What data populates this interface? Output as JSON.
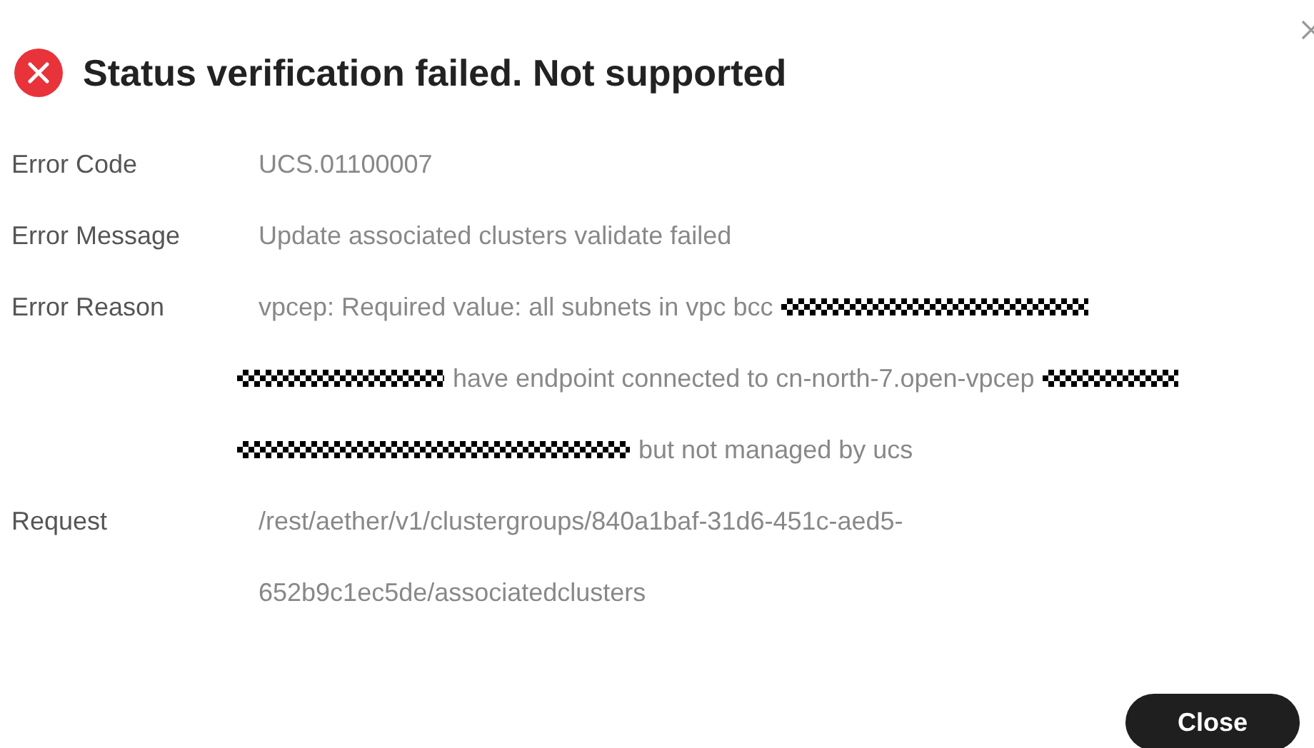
{
  "dialog": {
    "title": "Status verification failed. Not supported"
  },
  "fields": [
    {
      "label": "Error Code",
      "lines": [
        [
          {
            "kind": "text",
            "text": "UCS.01100007"
          }
        ]
      ]
    },
    {
      "label": "Error Message",
      "lines": [
        [
          {
            "kind": "text",
            "text": "Update associated clusters validate failed"
          }
        ]
      ]
    },
    {
      "label": "Error Reason",
      "lines": [
        [
          {
            "kind": "text",
            "text": "vpcep: Required value: all subnets in vpc bcc"
          },
          {
            "kind": "redaction"
          }
        ],
        [
          {
            "kind": "redaction"
          },
          {
            "kind": "text",
            "text": "have endpoint connected to cn-north-7.open-vpcep"
          },
          {
            "kind": "redaction"
          }
        ],
        [
          {
            "kind": "redaction"
          },
          {
            "kind": "text",
            "text": "but not managed by ucs"
          }
        ]
      ]
    },
    {
      "label": "Request",
      "lines": [
        [
          {
            "kind": "text",
            "text": "/rest/aether/v1/clustergroups/840a1baf-31d6-451c-aed5-"
          }
        ],
        [
          {
            "kind": "text",
            "text": "652b9c1ec5de/associatedclusters"
          }
        ]
      ]
    }
  ],
  "buttons": [
    {
      "label": "Close"
    }
  ]
}
